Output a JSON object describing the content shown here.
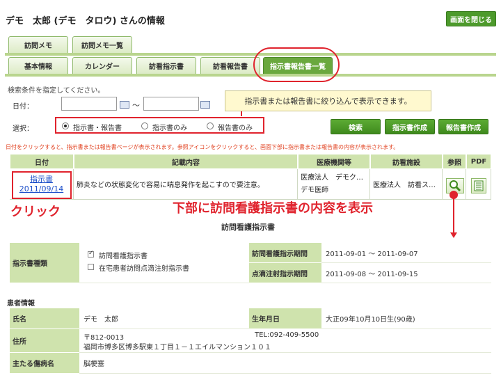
{
  "page_title": "デモ　太郎 (デモ　タロウ) さんの情報",
  "close_label": "画面を閉じる",
  "tabs_top": [
    {
      "label": "訪問メモ"
    },
    {
      "label": "訪問メモ一覧"
    }
  ],
  "tabs_main": [
    {
      "label": "基本情報"
    },
    {
      "label": "カレンダー"
    },
    {
      "label": "訪看指示書"
    },
    {
      "label": "訪看報告書"
    },
    {
      "label": "指示書報告書一覧"
    }
  ],
  "search": {
    "condition_label": "検索条件を指定してください。",
    "date_label": "日付：",
    "tilde": "〜",
    "date_from": "",
    "date_to": "",
    "select_label": "選択：",
    "options": [
      "指示書・報告書",
      "指示書のみ",
      "報告書のみ"
    ],
    "selected": "指示書・報告書"
  },
  "callout_text": "指示書または報告書に絞り込んで表示できます。",
  "buttons": {
    "search": "検索",
    "create_instruction": "指示書作成",
    "create_report": "報告書作成"
  },
  "notice": "日付をクリックすると、指示書または報告書ページが表示されます。参照アイコンをクリックすると、画面下部に指示書または報告書の内容が表示されます。",
  "table": {
    "headers": [
      "日付",
      "記載内容",
      "医療機関等",
      "訪看施設",
      "参照",
      "PDF"
    ],
    "row": {
      "date_type": "指示書",
      "date": "2011/09/14",
      "content": "肺炎などの状態変化で容易に喘息発作を起こすので要注意。",
      "institution": "医療法人　デモク…",
      "doctor": "デモ医師",
      "facility": "医療法人　訪看ス…"
    }
  },
  "annotations": {
    "click": "クリック",
    "bottom_display": "下部に訪問看護指示書の内容を表示"
  },
  "instruction": {
    "title": "訪問看護指示書",
    "type_label": "指示書種類",
    "type_options": [
      {
        "label": "訪問看護指示書",
        "checked": true
      },
      {
        "label": "在宅患者訪問点滴注射指示書",
        "checked": false
      }
    ],
    "period_label": "訪問看護指示期間",
    "period_value": "2011-09-01 〜 2011-09-07",
    "drip_label": "点滴注射指示期間",
    "drip_value": "2011-09-08 〜 2011-09-15"
  },
  "patient": {
    "header": "患者情報",
    "name_label": "氏名",
    "name_value": "デモ　太郎",
    "birth_label": "生年月日",
    "birth_value": "大正09年10月10日生(90歳)",
    "address_label": "住所",
    "zip": "〒812-0013",
    "address": "福岡市博多区博多駅東１丁目１－１エイルマンション１０１",
    "tel": "TEL:092-409-5500",
    "disease_label": "主たる傷病名",
    "disease_value": "脳梗塞"
  }
}
